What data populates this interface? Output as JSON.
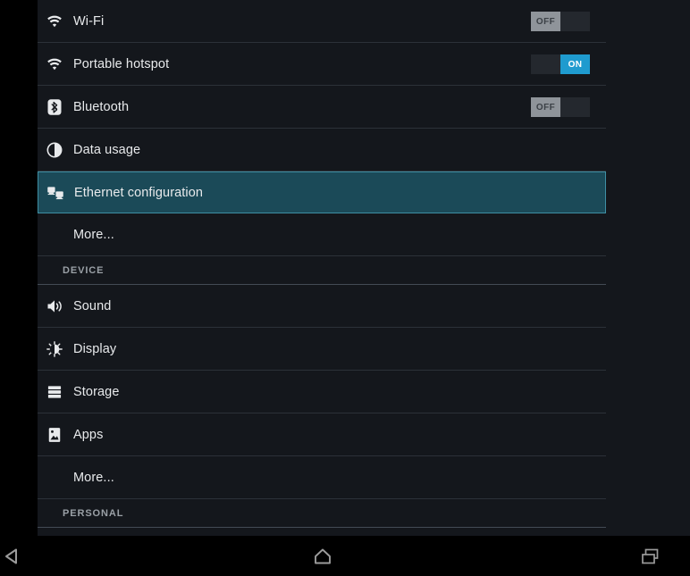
{
  "screen": {
    "app": "Android Settings",
    "background": "#000000",
    "panel_background": "#14171c",
    "accent_on": "#1f9bcf",
    "selection_fill": "#1b4a58",
    "selection_border": "#3f8fa3"
  },
  "settings": {
    "rows": [
      {
        "id": "wifi",
        "label": "Wi-Fi",
        "icon": "wifi-icon",
        "toggle": {
          "state": "off",
          "label": "OFF"
        },
        "indent": false,
        "selected": false
      },
      {
        "id": "portable-hotspot",
        "label": "Portable hotspot",
        "icon": "wifi-icon",
        "toggle": {
          "state": "on",
          "label": "ON"
        },
        "indent": false,
        "selected": false
      },
      {
        "id": "bluetooth",
        "label": "Bluetooth",
        "icon": "bluetooth-icon",
        "toggle": {
          "state": "off",
          "label": "OFF"
        },
        "indent": false,
        "selected": false
      },
      {
        "id": "data-usage",
        "label": "Data usage",
        "icon": "data-usage-icon",
        "toggle": null,
        "indent": false,
        "selected": false
      },
      {
        "id": "ethernet-configuration",
        "label": "Ethernet configuration",
        "icon": "ethernet-icon",
        "toggle": null,
        "indent": false,
        "selected": true
      },
      {
        "id": "more-wireless",
        "label": "More...",
        "icon": null,
        "toggle": null,
        "indent": true,
        "selected": false
      }
    ],
    "device_header": "DEVICE",
    "device_rows": [
      {
        "id": "sound",
        "label": "Sound",
        "icon": "sound-icon",
        "toggle": null,
        "indent": false,
        "selected": false
      },
      {
        "id": "display",
        "label": "Display",
        "icon": "display-icon",
        "toggle": null,
        "indent": false,
        "selected": false
      },
      {
        "id": "storage",
        "label": "Storage",
        "icon": "storage-icon",
        "toggle": null,
        "indent": false,
        "selected": false
      },
      {
        "id": "apps",
        "label": "Apps",
        "icon": "apps-icon",
        "toggle": null,
        "indent": false,
        "selected": false
      },
      {
        "id": "more-device",
        "label": "More...",
        "icon": null,
        "toggle": null,
        "indent": true,
        "selected": false
      }
    ],
    "personal_header": "PERSONAL"
  },
  "navbar": {
    "back": "back-icon",
    "home": "home-icon",
    "recents": "recents-icon"
  }
}
